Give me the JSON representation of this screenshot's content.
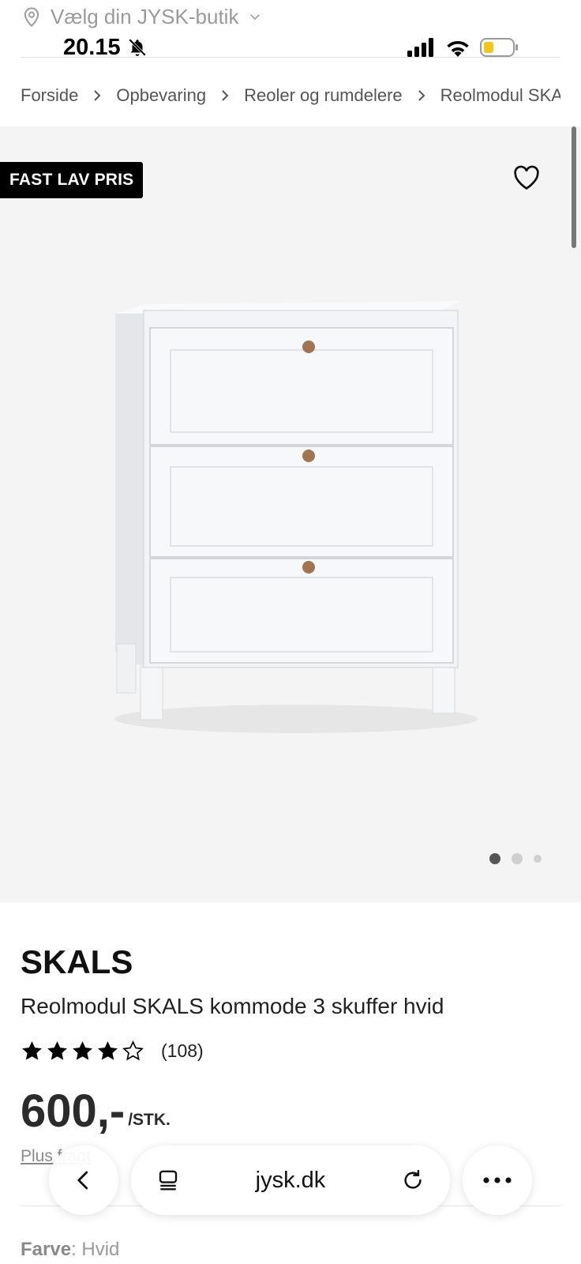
{
  "store_selector": {
    "label": "Vælg din JYSK-butik",
    "icon": "location-pin-icon"
  },
  "status_bar": {
    "time": "20.15",
    "battery_color": "#f5c518"
  },
  "breadcrumb": [
    "Forside",
    "Opbevaring",
    "Reoler og rumdelere",
    "Reolmodul SKALS"
  ],
  "gallery": {
    "badge": "FAST LAV PRIS",
    "image_alt": "Reolmodul SKALS kommode 3 skuffer hvid",
    "page_count": 3,
    "active_page": 1
  },
  "product": {
    "brand": "SKALS",
    "name": "Reolmodul SKALS kommode 3 skuffer hvid",
    "rating": 4,
    "rating_max": 5,
    "review_count": "(108)",
    "price": "600,-",
    "price_unit": "/STK.",
    "shipping_link": "Plus fragt",
    "color_label": "Farve",
    "color_value": ": Hvid"
  },
  "browser": {
    "url": "jysk.dk"
  },
  "colors": {
    "badge_bg": "#000000",
    "gallery_bg": "#f4f4f4",
    "text_muted": "#9a9a9a"
  }
}
